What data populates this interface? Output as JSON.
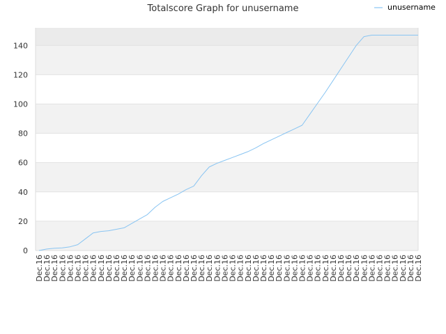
{
  "chart_data": {
    "type": "line",
    "title": "Totalscore Graph for unusername",
    "xlabel": "",
    "ylabel": "",
    "ylim": [
      0,
      152
    ],
    "yticks": [
      0,
      20,
      40,
      60,
      80,
      100,
      120,
      140
    ],
    "grid": "horizontal bands",
    "legend_position": "top-right",
    "categories": [
      "Dec.16",
      "Dec.16",
      "Dec.16",
      "Dec.16",
      "Dec.16",
      "Dec.16",
      "Dec.16",
      "Dec.16",
      "Dec.16",
      "Dec.16",
      "Dec.16",
      "Dec.16",
      "Dec.16",
      "Dec.16",
      "Dec.16",
      "Dec.16",
      "Dec.16",
      "Dec.16",
      "Dec.16",
      "Dec.16",
      "Dec.16",
      "Dec.16",
      "Dec.16",
      "Dec.16",
      "Dec.16",
      "Dec.16",
      "Dec.16",
      "Dec.16",
      "Dec.16",
      "Dec.16",
      "Dec.16",
      "Dec.16",
      "Dec.16",
      "Dec.16",
      "Dec.16",
      "Dec.16",
      "Dec.16",
      "Dec.16",
      "Dec.16",
      "Dec.16",
      "Dec.16",
      "Dec.16",
      "Dec.16",
      "Dec.16",
      "Dec.16",
      "Dec.16",
      "Dec.16",
      "Dec.16",
      "Dec.16",
      "Dec.16"
    ],
    "series": [
      {
        "name": "unusername",
        "color": "#88c4f2",
        "values": [
          0,
          1,
          1.5,
          1.8,
          2.5,
          4,
          8,
          12,
          13,
          13.5,
          14.5,
          15.5,
          18.5,
          21.5,
          24.5,
          29.5,
          33.5,
          36,
          38.5,
          41.5,
          44,
          51,
          57,
          59.5,
          61.5,
          63.5,
          65.5,
          67.5,
          70,
          73,
          75.5,
          78,
          80.5,
          83,
          85.5,
          93,
          100.5,
          108,
          116,
          124,
          132,
          140,
          146,
          147,
          147,
          147,
          147,
          147,
          147,
          147
        ]
      }
    ]
  },
  "colors": {
    "band": "#f2f2f2",
    "band_top": "#ebebeb",
    "gridline": "#e2e2e2",
    "axis": "#dddddd",
    "line": "#88c4f2"
  }
}
